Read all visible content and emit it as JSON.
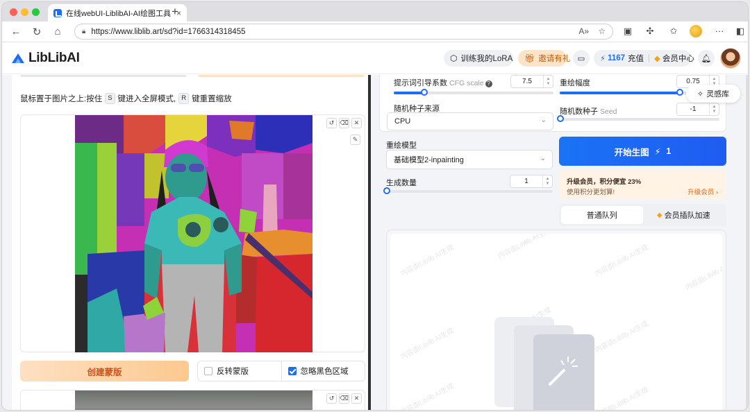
{
  "browser": {
    "tab_title": "在线webUI-LiblibAI-AI绘图工具",
    "tab_close": "×",
    "new_tab": "+",
    "url": "https://www.liblib.art/sd?id=1766314318455"
  },
  "site": {
    "logo_text": "LibLibAI",
    "train_lora": "训练我的LoRA",
    "invite": "邀请有礼",
    "points": "1167",
    "recharge": "充值",
    "member_center": "会员中心"
  },
  "left": {
    "hint_prefix": "鼠标置于图片之上:按住",
    "key_s": "S",
    "hint_mid": "键进入全屏模式,",
    "key_r": "R",
    "hint_suffix": "键重置缩放",
    "create_mask": "创建蒙版",
    "invert_mask": "反转蒙版",
    "invert_checked": false,
    "ignore_black": "忽略黑色区域",
    "ignore_checked": true
  },
  "right": {
    "cfg_label": "提示词引导系数",
    "cfg_label_en": "CFG scale",
    "cfg_value": "7.5",
    "cfg_fraction": 0.19,
    "denoise_label": "重绘幅度",
    "denoise_value": "0.75",
    "denoise_fraction": 0.75,
    "seed_source_label": "随机种子来源",
    "seed_source_value": "CPU",
    "seed_label": "随机数种子",
    "seed_label_en": "Seed",
    "seed_value": "-1",
    "model_label": "重绘模型",
    "model_value": "基础模型2-inpainting",
    "count_label": "生成数量",
    "count_value": "1",
    "generate": "开始生图",
    "generate_cost": "1",
    "vip_title": "升级会员，积分便宜 23%",
    "vip_sub": "使用积分更划算!",
    "vip_link": "升级会员 ›",
    "queue_normal": "普通队列",
    "queue_vip": "会员插队加速",
    "watermark": "内容由Liblib AI生成",
    "inspire": "灵感库"
  },
  "colors": {
    "accent": "#1e6df2",
    "orange": "#e5650c"
  }
}
